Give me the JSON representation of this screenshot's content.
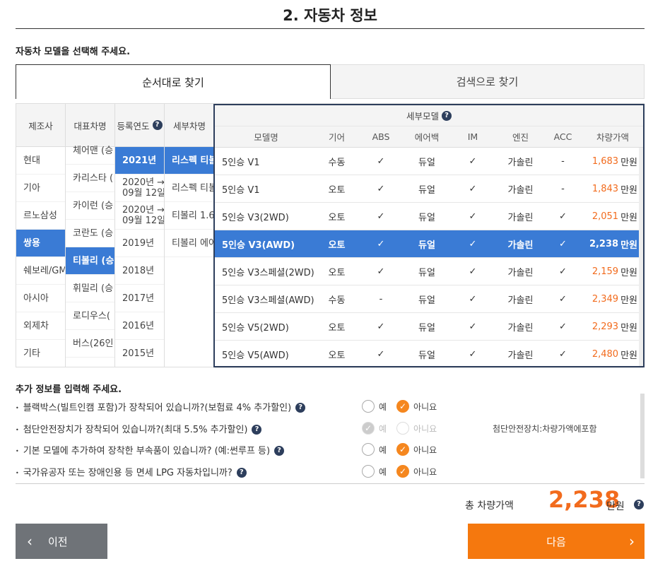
{
  "page": {
    "title": "2. 자동차 정보",
    "select_prompt": "자동차 모델을 선택해 주세요."
  },
  "tabs": [
    {
      "label": "순서대로 찾기"
    },
    {
      "label": "검색으로 찾기"
    }
  ],
  "columns": {
    "maker": {
      "header": "제조사",
      "items": [
        "현대",
        "기아",
        "르노삼성",
        "쌍용",
        "쉐보레/GM",
        "아시아",
        "외제차",
        "기타"
      ],
      "selected": "쌍용"
    },
    "model": {
      "header": "대표차명",
      "items": [
        "체어맨 (승",
        "카리스타 (",
        "카이런 (승",
        "코란도 (승",
        "티볼리 (승",
        "휘밀리 (승",
        "로디우스(",
        "버스(26인",
        "..."
      ],
      "selected": "티볼리 (승"
    },
    "year": {
      "header": "등록연도",
      "items": [
        "2021년",
        "2020년 →\n09월 12일",
        "2020년 →\n09월 12일",
        "2019년",
        "2018년",
        "2017년",
        "2016년",
        "2015년"
      ],
      "selected": "2021년"
    },
    "submodel": {
      "header": "세부차명",
      "items": [
        "리스펙 티볼",
        "리스펙 티볼",
        "티볼리 1.6",
        "티볼리 에어"
      ],
      "selected": "리스펙 티볼"
    }
  },
  "detail": {
    "header": "세부모델",
    "columns": [
      "모델명",
      "기어",
      "ABS",
      "에어백",
      "IM",
      "엔진",
      "ACC",
      "차량가액"
    ],
    "price_unit": "만원",
    "rows": [
      {
        "model": "5인승 V1",
        "gear": "수동",
        "abs": "✓",
        "airbag": "듀얼",
        "im": "✓",
        "engine": "가솔린",
        "acc": "-",
        "price": "1,683"
      },
      {
        "model": "5인승 V1",
        "gear": "오토",
        "abs": "✓",
        "airbag": "듀얼",
        "im": "✓",
        "engine": "가솔린",
        "acc": "-",
        "price": "1,843"
      },
      {
        "model": "5인승 V3(2WD)",
        "gear": "오토",
        "abs": "✓",
        "airbag": "듀얼",
        "im": "✓",
        "engine": "가솔린",
        "acc": "✓",
        "price": "2,051"
      },
      {
        "model": "5인승 V3(AWD)",
        "gear": "오토",
        "abs": "✓",
        "airbag": "듀얼",
        "im": "✓",
        "engine": "가솔린",
        "acc": "✓",
        "price": "2,238",
        "selected": true
      },
      {
        "model": "5인승 V3스페셜(2WD)",
        "gear": "오토",
        "abs": "✓",
        "airbag": "듀얼",
        "im": "✓",
        "engine": "가솔린",
        "acc": "✓",
        "price": "2,159"
      },
      {
        "model": "5인승 V3스페셜(AWD)",
        "gear": "수동",
        "abs": "-",
        "airbag": "듀얼",
        "im": "✓",
        "engine": "가솔린",
        "acc": "✓",
        "price": "2,349"
      },
      {
        "model": "5인승 V5(2WD)",
        "gear": "오토",
        "abs": "✓",
        "airbag": "듀얼",
        "im": "✓",
        "engine": "가솔린",
        "acc": "✓",
        "price": "2,293"
      },
      {
        "model": "5인승 V5(AWD)",
        "gear": "오토",
        "abs": "✓",
        "airbag": "듀얼",
        "im": "✓",
        "engine": "가솔린",
        "acc": "✓",
        "price": "2,480"
      }
    ]
  },
  "extra": {
    "title": "추가 정보를 입력해 주세요.",
    "yes_label": "예",
    "no_label": "아니요",
    "questions": [
      {
        "text": "블랙박스(빌트인캠 포함)가 장착되어 있습니까?(보험료 4% 추가할인)",
        "answer": "no",
        "disabled": false,
        "note": ""
      },
      {
        "text": "첨단안전장치가 장착되어 있습니까?(최대 5.5% 추가할인)",
        "answer": "yes",
        "disabled": true,
        "note": "첨단안전장치:차량가액에포함"
      },
      {
        "text": "기본 모델에 추가하여 장착한 부속품이 있습니까? (예:썬루프 등)",
        "answer": "no",
        "disabled": false,
        "note": ""
      },
      {
        "text": "국가유공자 또는 장애인용 등 면세 LPG 자동차입니까?",
        "answer": "no",
        "disabled": false,
        "note": ""
      }
    ]
  },
  "total": {
    "label": "총 차량가액",
    "value": "2,238",
    "unit": "만원"
  },
  "buttons": {
    "prev": "이전",
    "next": "다음"
  },
  "colors": {
    "accent_orange": "#f5780e",
    "selected_blue": "#3a7bd5",
    "price_orange": "#f26b1d"
  }
}
